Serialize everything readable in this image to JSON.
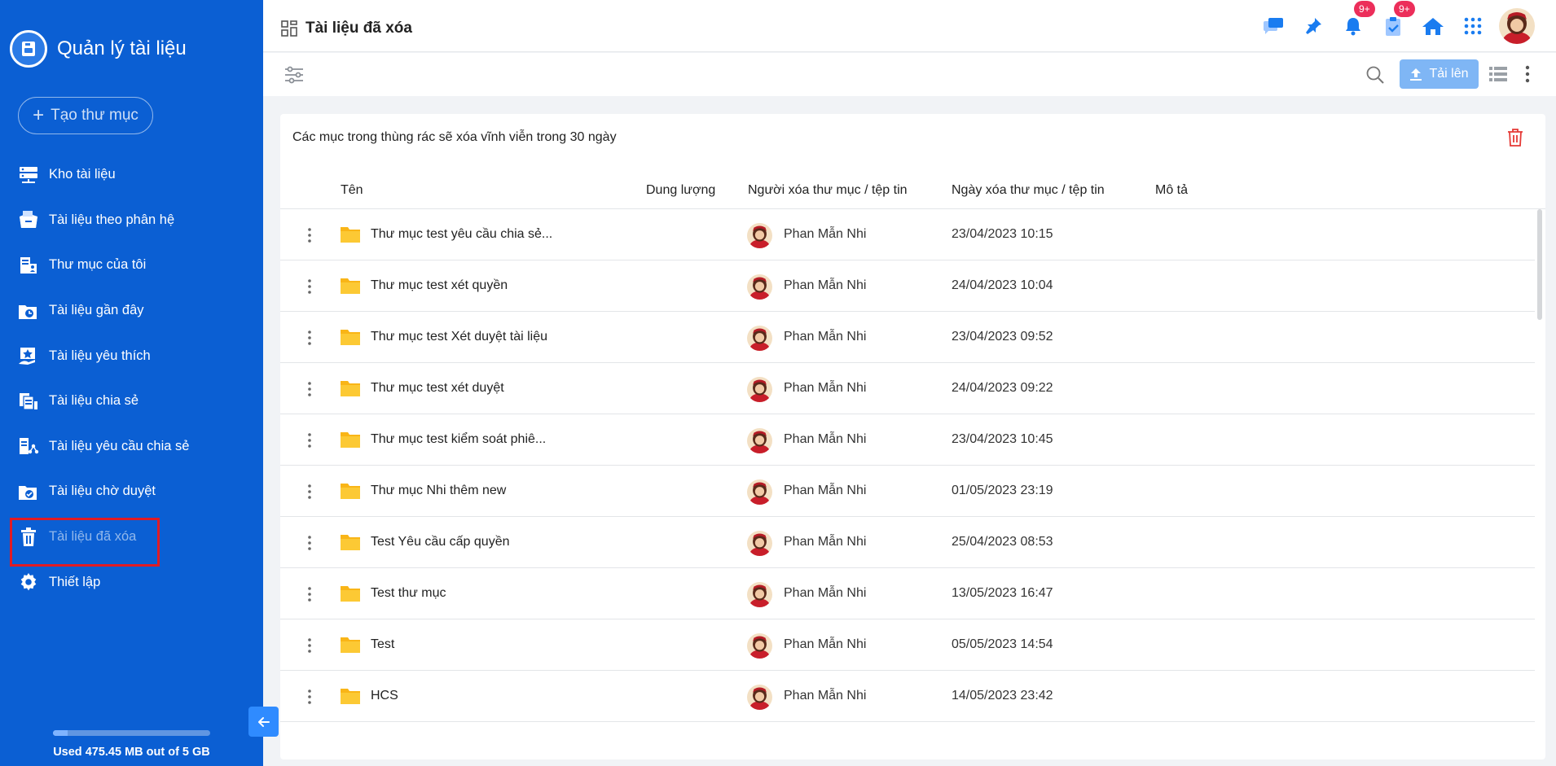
{
  "app": {
    "title": "Quản lý tài liệu",
    "create_folder_label": "Tạo thư mục",
    "storage_text": "Used 475.45 MB out of 5 GB",
    "storage_used_fraction": 0.093
  },
  "sidebar": {
    "items": [
      {
        "label": "Kho tài liệu",
        "icon": "server-icon"
      },
      {
        "label": "Tài liệu theo phân hệ",
        "icon": "module-docs-icon"
      },
      {
        "label": "Thư mục của tôi",
        "icon": "my-folder-icon"
      },
      {
        "label": "Tài liệu gần đây",
        "icon": "recent-icon"
      },
      {
        "label": "Tài liệu yêu thích",
        "icon": "favorite-icon"
      },
      {
        "label": "Tài liệu chia sẻ",
        "icon": "shared-icon"
      },
      {
        "label": "Tài liệu yêu cầu chia sẻ",
        "icon": "share-request-icon"
      },
      {
        "label": "Tài liệu chờ duyệt",
        "icon": "pending-approval-icon"
      },
      {
        "label": "Tài liệu đã xóa",
        "icon": "trash-icon",
        "active": true
      },
      {
        "label": "Thiết lập",
        "icon": "gear-icon"
      }
    ]
  },
  "header": {
    "title": "Tài liệu đã xóa",
    "notification_badge": "9+",
    "task_badge": "9+"
  },
  "toolbar": {
    "upload_label": "Tải lên"
  },
  "main": {
    "notice": "Các mục trong thùng rác sẽ xóa vĩnh viễn trong 30 ngày",
    "columns": [
      "Tên",
      "Dung lượng",
      "Người xóa thư mục / tệp tin",
      "Ngày xóa thư mục / tệp tin",
      "Mô tả"
    ],
    "rows": [
      {
        "name": "Thư mục test yêu cầu chia sẻ...",
        "deleted_by": "Phan Mẫn Nhi",
        "deleted_at": "23/04/2023 10:15"
      },
      {
        "name": "Thư mục test xét quyền",
        "deleted_by": "Phan Mẫn Nhi",
        "deleted_at": "24/04/2023 10:04"
      },
      {
        "name": "Thư mục test Xét duyệt tài liệu",
        "deleted_by": "Phan Mẫn Nhi",
        "deleted_at": "23/04/2023 09:52"
      },
      {
        "name": "Thư mục test xét duyệt",
        "deleted_by": "Phan Mẫn Nhi",
        "deleted_at": "24/04/2023 09:22"
      },
      {
        "name": "Thư mục test kiểm soát phiê...",
        "deleted_by": "Phan Mẫn Nhi",
        "deleted_at": "23/04/2023 10:45"
      },
      {
        "name": "Thư mục Nhi thêm new",
        "deleted_by": "Phan Mẫn Nhi",
        "deleted_at": "01/05/2023 23:19"
      },
      {
        "name": "Test Yêu cầu cấp quyền",
        "deleted_by": "Phan Mẫn Nhi",
        "deleted_at": "25/04/2023 08:53"
      },
      {
        "name": "Test thư mục",
        "deleted_by": "Phan Mẫn Nhi",
        "deleted_at": "13/05/2023 16:47"
      },
      {
        "name": "Test",
        "deleted_by": "Phan Mẫn Nhi",
        "deleted_at": "05/05/2023 14:54"
      },
      {
        "name": "HCS",
        "deleted_by": "Phan Mẫn Nhi",
        "deleted_at": "14/05/2023 23:42"
      }
    ]
  },
  "colors": {
    "sidebar_bg": "#0b5fd3",
    "accent": "#1a7cf0",
    "badge": "#ec2e5a",
    "folder": "#fbc02d",
    "danger": "#e53935"
  }
}
